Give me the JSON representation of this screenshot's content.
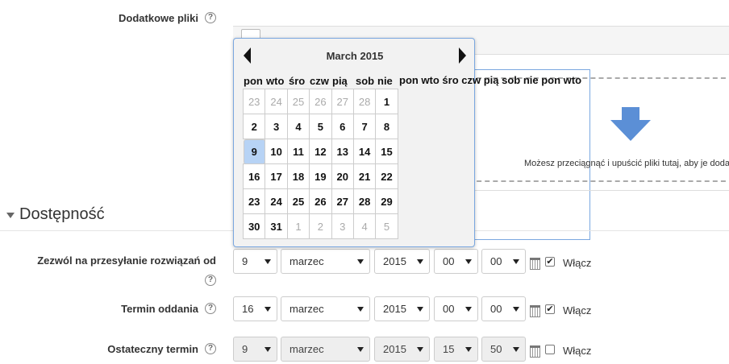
{
  "fields": {
    "extra_files": "Dodatkowe pliki",
    "allow_from": "Zezwól na przesyłanie rozwiązań od",
    "due_date": "Termin oddania",
    "cutoff": "Ostateczny termin"
  },
  "help_glyph": "?",
  "dropzone_text": "Możesz przeciągnąć i upuścić pliki tutaj, aby je doda",
  "section": {
    "title": "Dostępność"
  },
  "calendar": {
    "title": "March 2015",
    "weekdays": [
      "pon",
      "wto",
      "śro",
      "czw",
      "pią",
      "sob",
      "nie"
    ],
    "weekdays_overflow": "pon wto śro czw pią sob nie pon wto",
    "weeks": [
      [
        "23",
        "24",
        "25",
        "26",
        "27",
        "28",
        "1"
      ],
      [
        "2",
        "3",
        "4",
        "5",
        "6",
        "7",
        "8"
      ],
      [
        "9",
        "10",
        "11",
        "12",
        "13",
        "14",
        "15"
      ],
      [
        "16",
        "17",
        "18",
        "19",
        "20",
        "21",
        "22"
      ],
      [
        "23",
        "24",
        "25",
        "26",
        "27",
        "28",
        "29"
      ],
      [
        "30",
        "31",
        "1",
        "2",
        "3",
        "4",
        "5"
      ]
    ],
    "selected_day": "9"
  },
  "rows": [
    {
      "day": "9",
      "month": "marzec",
      "year": "2015",
      "hour": "00",
      "minute": "00",
      "enabled": true,
      "enable_label": "Włącz"
    },
    {
      "day": "16",
      "month": "marzec",
      "year": "2015",
      "hour": "00",
      "minute": "00",
      "enabled": true,
      "enable_label": "Włącz"
    },
    {
      "day": "9",
      "month": "marzec",
      "year": "2015",
      "hour": "15",
      "minute": "50",
      "enabled": false,
      "enable_label": "Włącz"
    }
  ]
}
